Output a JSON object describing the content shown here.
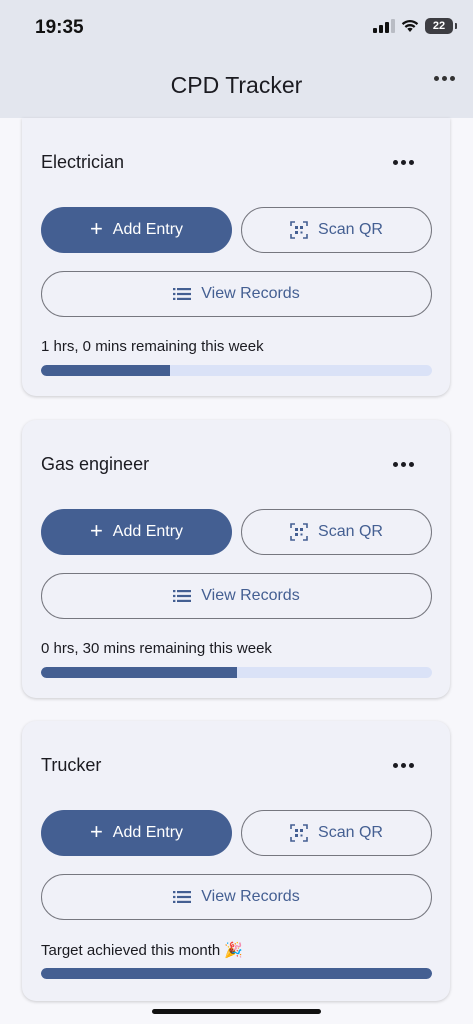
{
  "status": {
    "time": "19:35",
    "battery": "22"
  },
  "app": {
    "title": "CPD Tracker"
  },
  "cards": [
    {
      "title": "Electrician",
      "add_label": "Add Entry",
      "scan_label": "Scan QR",
      "view_label": "View Records",
      "remaining": "1 hrs, 0 mins remaining this week",
      "progress": 0.33
    },
    {
      "title": "Gas engineer",
      "add_label": "Add Entry",
      "scan_label": "Scan QR",
      "view_label": "View Records",
      "remaining": "0 hrs, 30 mins remaining this week",
      "progress": 0.5
    },
    {
      "title": "Trucker",
      "add_label": "Add Entry",
      "scan_label": "Scan QR",
      "view_label": "View Records",
      "remaining": "Target achieved this month 🎉",
      "progress": 1.0
    }
  ],
  "colors": {
    "accent": "#445f92",
    "track": "#dae2f7",
    "header": "#e3e6ee",
    "card": "#f0f1f8"
  },
  "icons": {
    "add": "plus-icon",
    "scan": "qr-scan-icon",
    "view": "list-icon",
    "menu": "more-horizontal-icon"
  }
}
